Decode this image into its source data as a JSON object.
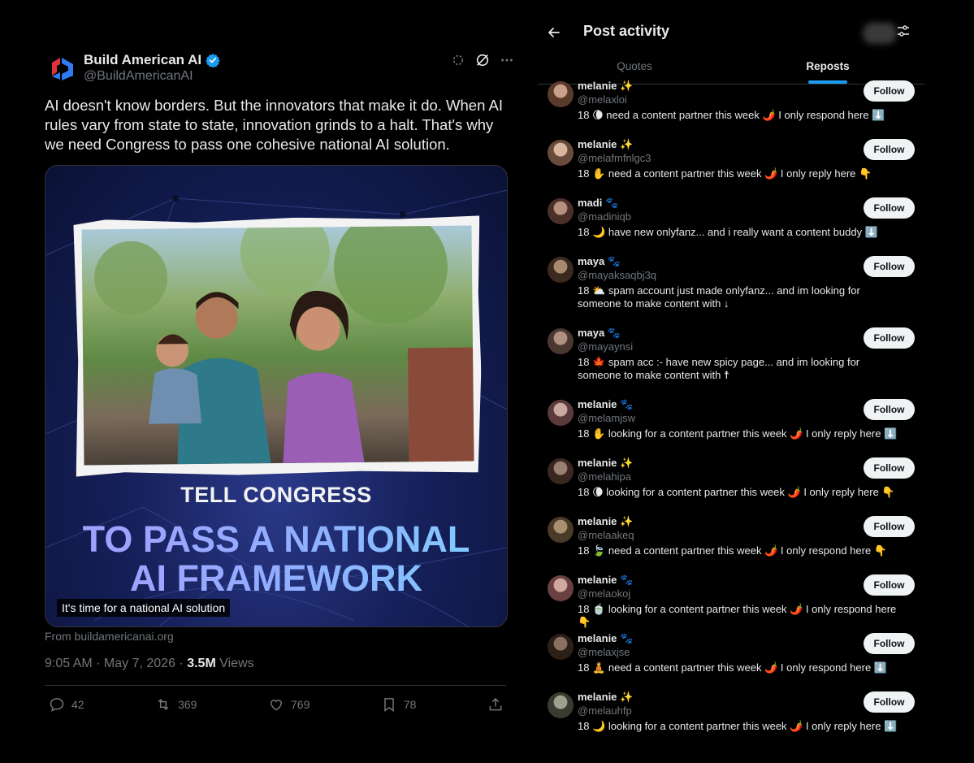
{
  "post": {
    "author_name": "Build American AI",
    "author_handle": "@BuildAmericanAI",
    "text": "AI doesn't know borders. But the innovators that make it do. When AI rules vary from state to state, innovation grinds to a halt. That's why we need Congress to pass one cohesive national AI solution.",
    "media": {
      "title_line1": "TELL CONGRESS",
      "title_line2": "TO PASS A NATIONAL",
      "title_line3": "AI FRAMEWORK",
      "caption": "It's time for a national AI solution"
    },
    "source": "From buildamericanai.org",
    "time": "9:05 AM · May 7, 2026 · ",
    "views_count": "3.5M",
    "views_label": "Views",
    "stats": {
      "replies": "42",
      "reposts": "369",
      "likes": "769",
      "bookmarks": "78"
    },
    "colors": {
      "verified": "#1d9bf0",
      "muted": "#71767b"
    }
  },
  "panel": {
    "title": "Post activity",
    "tabs": [
      {
        "label": "Quotes"
      },
      {
        "label": "Reposts"
      }
    ],
    "active_tab": "Reposts",
    "follow_label": "Follow",
    "users": [
      {
        "name": "melanie ✨",
        "handle": "@melaxloi",
        "bio": "18 🌘 need a content partner this week 🌶️ I only respond here ⬇️"
      },
      {
        "name": "melanie ✨",
        "handle": "@melafmfnlgc3",
        "bio": "18 ✋ need a content partner this week 🌶️ I only reply here 👇"
      },
      {
        "name": "madi 🐾",
        "handle": "@madiniqb",
        "bio": "18 🌙 have new onlyfanz... and i really want a content buddy ⬇️"
      },
      {
        "name": "maya 🐾",
        "handle": "@mayaksaqbj3q",
        "bio": "18 ⛅ spam account just made onlyfanz... and im looking for someone to make content with ↓"
      },
      {
        "name": "maya 🐾",
        "handle": "@mayaynsi",
        "bio": "18 🍁 spam acc :- have new spicy page... and im looking for someone to make content with ☨"
      },
      {
        "name": "melanie 🐾",
        "handle": "@melamjsw",
        "bio": "18 ✋ looking for a content partner this week 🌶️ I only reply here ⬇️"
      },
      {
        "name": "melanie ✨",
        "handle": "@melahipa",
        "bio": "18 🌘 looking for a content partner this week 🌶️ I only reply here 👇"
      },
      {
        "name": "melanie ✨",
        "handle": "@melaakeq",
        "bio": "18 🍃 need a content partner this week 🌶️ I only respond here 👇"
      },
      {
        "name": "melanie 🐾",
        "handle": "@melaokoj",
        "bio": "18 🍵 looking for a content partner this week 🌶️ I only respond here 👇"
      },
      {
        "name": "melanie 🐾",
        "handle": "@melaxjse",
        "bio": "18 🧘 need a content partner this week 🌶️ I only respond here ⬇️"
      },
      {
        "name": "melanie ✨",
        "handle": "@melauhfp",
        "bio": "18 🌙 looking for a content partner this week 🌶️ I only reply here ⬇️"
      }
    ]
  }
}
